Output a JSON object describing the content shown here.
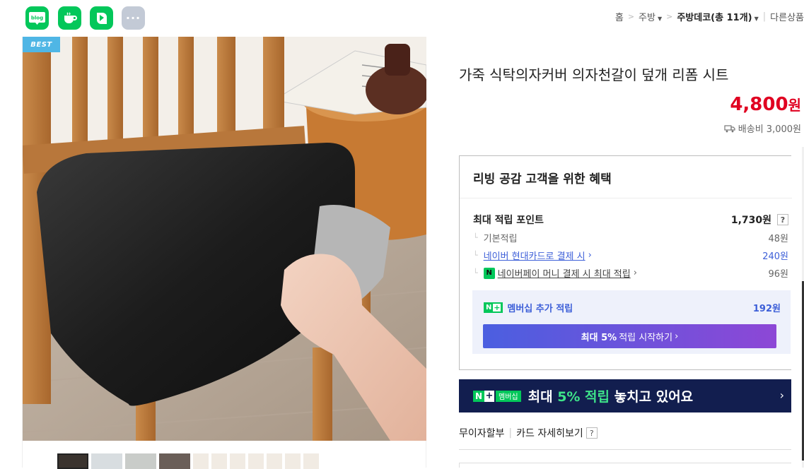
{
  "share": {
    "items": [
      {
        "name": "blog",
        "label": "blog"
      },
      {
        "name": "cafe",
        "label": ""
      },
      {
        "name": "band",
        "label": ""
      },
      {
        "name": "more",
        "label": "···"
      }
    ]
  },
  "breadcrumb": {
    "home": "홈",
    "level1": "주방",
    "level2": "주방데코(총 11개)",
    "other": "다른상품"
  },
  "product": {
    "badge": "BEST",
    "title": "가죽 식탁의자커버 의자천갈이 덮개 리폼 시트",
    "price": "4,800",
    "price_unit": "원",
    "shipping": "배송비 3,000원"
  },
  "benefit": {
    "heading": "리빙 공감 고객을 위한 혜택",
    "max_point_label": "최대 적립 포인트",
    "max_point_value": "1,730원",
    "qmark": "?",
    "rows": [
      {
        "label": "기본적립",
        "value": "48원"
      },
      {
        "label": "네이버 현대카드로 결제 시",
        "value": "240원"
      },
      {
        "label": "네이버페이 머니 결제 시 최대 적립",
        "value": "96원"
      }
    ],
    "npay_icon": "N",
    "membership": {
      "badge_n": "N",
      "badge_plus": "+",
      "label": "멤버십 추가 적립",
      "value": "192원",
      "button_bold": "최대 5%",
      "button_rest": "적립 시작하기"
    }
  },
  "banner": {
    "n": "N",
    "plus": "+",
    "membership": "멤버십",
    "text_pre": "최대 ",
    "text_hl": "5% 적립",
    "text_post": " 놓치고 있어요"
  },
  "payment": {
    "installment": "무이자할부",
    "card_detail": "카드 자세히보기",
    "qmark": "?"
  },
  "colors": {
    "naver_green": "#03c75a",
    "price_red": "#e00021",
    "link_blue": "#3d5fd8",
    "banner_navy": "#121e4f"
  }
}
